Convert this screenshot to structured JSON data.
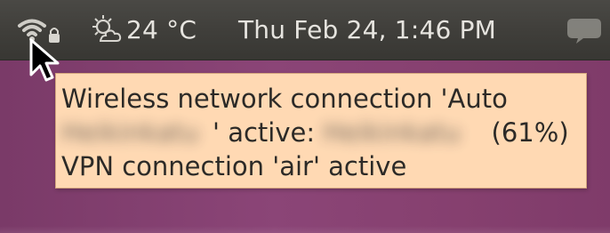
{
  "panel": {
    "weather_temperature": "24 °C",
    "clock_text": "Thu Feb 24,  1:46 PM"
  },
  "tooltip": {
    "line1": "Wireless network connection 'Auto",
    "line2_blurred_name": "Heikinkatu",
    "line2_mid": "' active: ",
    "line2_blurred_signal": "Heikinkatu",
    "line2_signal_strength": " (61%)",
    "line3": "VPN connection 'air' active"
  },
  "colors": {
    "panel_bg": "#3f3e3a",
    "panel_text": "#e6e4df",
    "tooltip_bg": "#ffd9b3",
    "tooltip_border": "#d4a57e",
    "desktop_bg": "#8b4577"
  },
  "icons": {
    "wifi": "wifi-icon",
    "lock": "lock-icon",
    "weather": "sun-cloud-icon",
    "chat": "chat-bubble-icon",
    "cursor": "mouse-pointer-icon"
  }
}
